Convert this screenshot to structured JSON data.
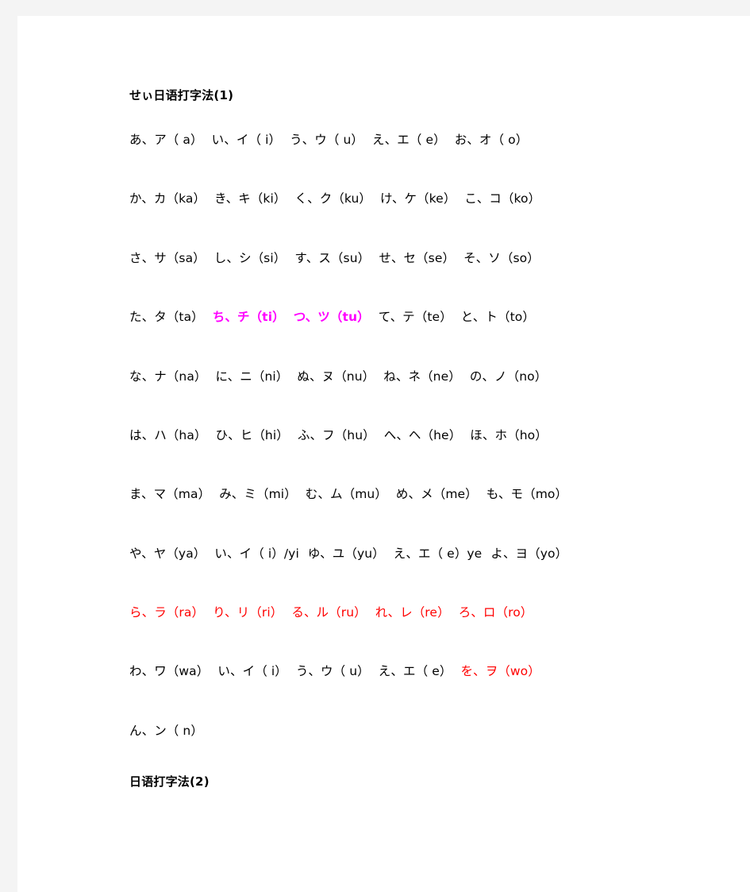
{
  "document": {
    "heading_1": "せぃ日语打字法(1)",
    "heading_2": "日语打字法(2)",
    "colors": {
      "page_background": "#ffffff",
      "outer_background": "#f4f4f4",
      "text_default": "#000000",
      "highlight_magenta": "#ff00ff",
      "highlight_red": "#ff0000"
    },
    "rows": [
      {
        "id": "row-a",
        "cells": [
          {
            "text": "あ、ア（ a）",
            "color": "black"
          },
          {
            "text": "い、イ（ i）",
            "color": "black"
          },
          {
            "text": "う、ウ（ u）",
            "color": "black"
          },
          {
            "text": "え、エ（ e）",
            "color": "black"
          },
          {
            "text": "お、オ（ o）",
            "color": "black"
          }
        ]
      },
      {
        "id": "row-ka",
        "cells": [
          {
            "text": "か、カ（ka）",
            "color": "black"
          },
          {
            "text": "き、キ（ki）",
            "color": "black"
          },
          {
            "text": "く、ク（ku）",
            "color": "black"
          },
          {
            "text": "け、ケ（ke）",
            "color": "black"
          },
          {
            "text": "こ、コ（ko）",
            "color": "black"
          }
        ]
      },
      {
        "id": "row-sa",
        "cells": [
          {
            "text": "さ、サ（sa）",
            "color": "black"
          },
          {
            "text": "し、シ（si）",
            "color": "black"
          },
          {
            "text": "す、ス（su）",
            "color": "black"
          },
          {
            "text": "せ、セ（se）",
            "color": "black"
          },
          {
            "text": "そ、ソ（so）",
            "color": "black"
          }
        ]
      },
      {
        "id": "row-ta",
        "cells": [
          {
            "text": "た、タ（ta）",
            "color": "black"
          },
          {
            "text": "ち、チ（ti）",
            "color": "magenta"
          },
          {
            "text": "つ、ツ（tu）",
            "color": "magenta"
          },
          {
            "text": "て、テ（te）",
            "color": "black"
          },
          {
            "text": "と、ト（to）",
            "color": "black"
          }
        ]
      },
      {
        "id": "row-na",
        "cells": [
          {
            "text": "な、ナ（na）",
            "color": "black"
          },
          {
            "text": "に、ニ（ni）",
            "color": "black"
          },
          {
            "text": "ぬ、ヌ（nu）",
            "color": "black"
          },
          {
            "text": "ね、ネ（ne）",
            "color": "black"
          },
          {
            "text": "の、ノ（no）",
            "color": "black"
          }
        ]
      },
      {
        "id": "row-ha",
        "cells": [
          {
            "text": "は、ハ（ha）",
            "color": "black"
          },
          {
            "text": "ひ、ヒ（hi）",
            "color": "black"
          },
          {
            "text": "ふ、フ（hu）",
            "color": "black"
          },
          {
            "text": "へ、ヘ（he）",
            "color": "black"
          },
          {
            "text": "ほ、ホ（ho）",
            "color": "black"
          }
        ]
      },
      {
        "id": "row-ma",
        "cells": [
          {
            "text": "ま、マ（ma）",
            "color": "black"
          },
          {
            "text": "み、ミ（mi）",
            "color": "black"
          },
          {
            "text": "む、ム（mu）",
            "color": "black"
          },
          {
            "text": "め、メ（me）",
            "color": "black"
          },
          {
            "text": "も、モ（mo）",
            "color": "black"
          }
        ]
      },
      {
        "id": "row-ya",
        "cells": [
          {
            "text": "や、ヤ（ya）",
            "color": "black"
          },
          {
            "text": "い、イ（ i）/yi",
            "color": "black"
          },
          {
            "text": "ゆ、ユ（yu）",
            "color": "black"
          },
          {
            "text": "え、エ（ e）ye",
            "color": "black"
          },
          {
            "text": "よ、ヨ（yo）",
            "color": "black"
          }
        ]
      },
      {
        "id": "row-ra",
        "cells": [
          {
            "text": "ら、ラ（ra）",
            "color": "red"
          },
          {
            "text": "り、リ（ri）",
            "color": "red"
          },
          {
            "text": "る、ル（ru）",
            "color": "red"
          },
          {
            "text": "れ、レ（re）",
            "color": "red"
          },
          {
            "text": "ろ、ロ（ro）",
            "color": "red"
          }
        ]
      },
      {
        "id": "row-wa",
        "cells": [
          {
            "text": "わ、ワ（wa）",
            "color": "black"
          },
          {
            "text": "い、イ（ i）",
            "color": "black"
          },
          {
            "text": "う、ウ（ u）",
            "color": "black"
          },
          {
            "text": "え、エ（ e）",
            "color": "black"
          },
          {
            "text": "を、ヲ（wo）",
            "color": "red"
          }
        ]
      },
      {
        "id": "row-n",
        "cells": [
          {
            "text": "ん、ン（ n）",
            "color": "black"
          }
        ]
      }
    ]
  }
}
